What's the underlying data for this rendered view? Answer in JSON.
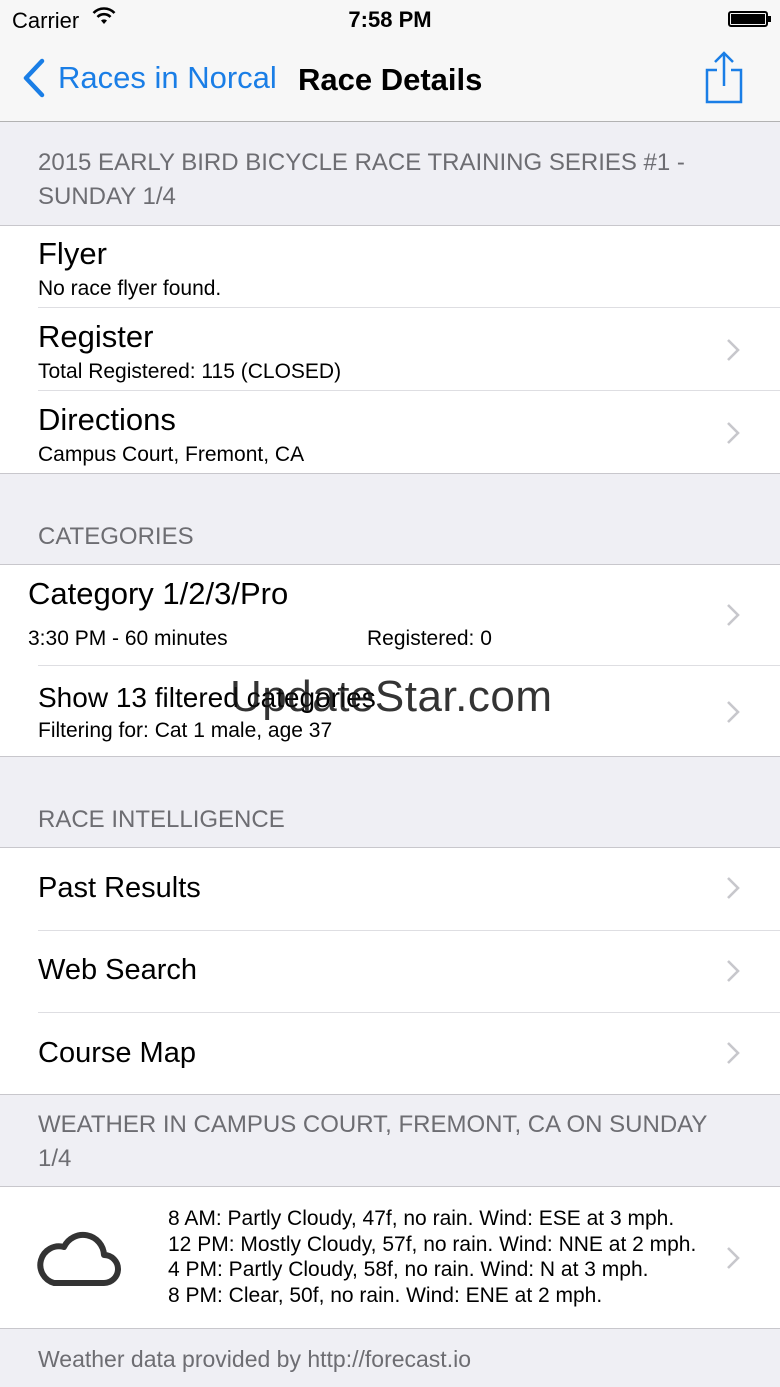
{
  "status_bar": {
    "carrier": "Carrier",
    "time": "7:58 PM"
  },
  "nav": {
    "back_label": "Races in Norcal",
    "title": "Race Details",
    "share_icon": "share-icon"
  },
  "race": {
    "header": "2015 EARLY BIRD BICYCLE RACE TRAINING SERIES #1 - SUNDAY 1/4",
    "rows": [
      {
        "title": "Flyer",
        "subtitle": "No race flyer found."
      },
      {
        "title": "Register",
        "subtitle": "Total Registered: 115 (CLOSED)"
      },
      {
        "title": "Directions",
        "subtitle": "Campus Court, Fremont, CA"
      }
    ]
  },
  "categories": {
    "header": "CATEGORIES",
    "category": {
      "name": "Category 1/2/3/Pro",
      "time": "3:30 PM - 60 minutes",
      "registered": "Registered: 0"
    },
    "filter": {
      "title": "Show 13 filtered categories",
      "subtitle": "Filtering for: Cat 1 male, age 37"
    }
  },
  "intelligence": {
    "header": "RACE INTELLIGENCE",
    "items": [
      "Past Results",
      "Web Search",
      "Course Map"
    ]
  },
  "weather": {
    "header": "WEATHER IN CAMPUS COURT, FREMONT, CA ON SUNDAY 1/4",
    "icon": "cloud-icon",
    "lines": [
      "8 AM: Partly Cloudy, 47f, no rain. Wind: ESE at 3 mph.",
      "12 PM: Mostly Cloudy, 57f, no rain. Wind: NNE at 2 mph.",
      "4 PM: Partly Cloudy, 58f, no rain. Wind: N at 3 mph.",
      "8 PM: Clear, 50f, no rain. Wind: ENE at 2 mph."
    ],
    "footer": "Weather data provided by http://forecast.io"
  },
  "watermark": "UpdateStar.com",
  "colors": {
    "accent": "#1a7ee6",
    "background": "#efeff4",
    "header_text": "#6d6d72"
  }
}
